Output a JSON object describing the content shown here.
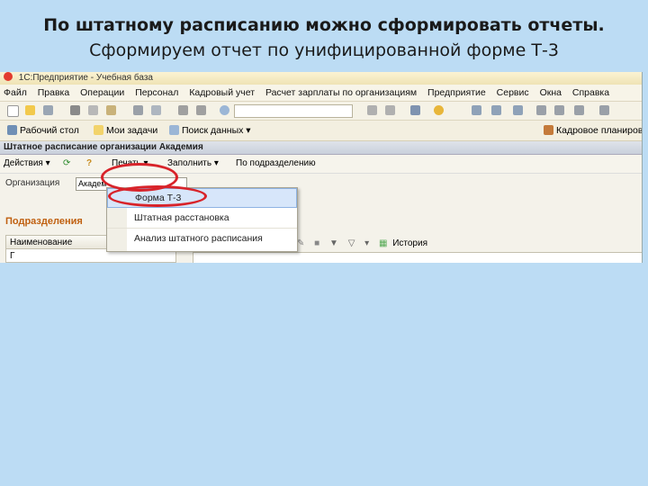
{
  "slide": {
    "line1": "По штатному расписанию можно сформировать отчеты.",
    "line2": "Сформируем отчет по унифицированной форме Т-3"
  },
  "app": {
    "title": "1С:Предприятие - Учебная база"
  },
  "menu": [
    "Файл",
    "Правка",
    "Операции",
    "Персонал",
    "Кадровый учет",
    "Расчет зарплаты по организациям",
    "Предприятие",
    "Сервис",
    "Окна",
    "Справка"
  ],
  "panel": {
    "desktop": "Рабочий стол",
    "tasks": "Мои задачи",
    "search": "Поиск данных",
    "hr": "Кадровое планиров"
  },
  "document": {
    "title": "Штатное расписание организации Академия",
    "actions": "Действия",
    "print": "Печать",
    "fill": "Заполнить",
    "by_unit": "По подразделению"
  },
  "form": {
    "org_label": "Организация",
    "org_value": "Академ",
    "section": "Подразделения",
    "column": "Наименование",
    "row": "Г",
    "history": "История"
  },
  "print_menu": [
    "Форма Т-3",
    "Штатная расстановка",
    "Анализ штатного расписания"
  ],
  "colors": {
    "accent_ring": "#d8232a",
    "section": "#c06010",
    "background": "#bcdcf4"
  }
}
